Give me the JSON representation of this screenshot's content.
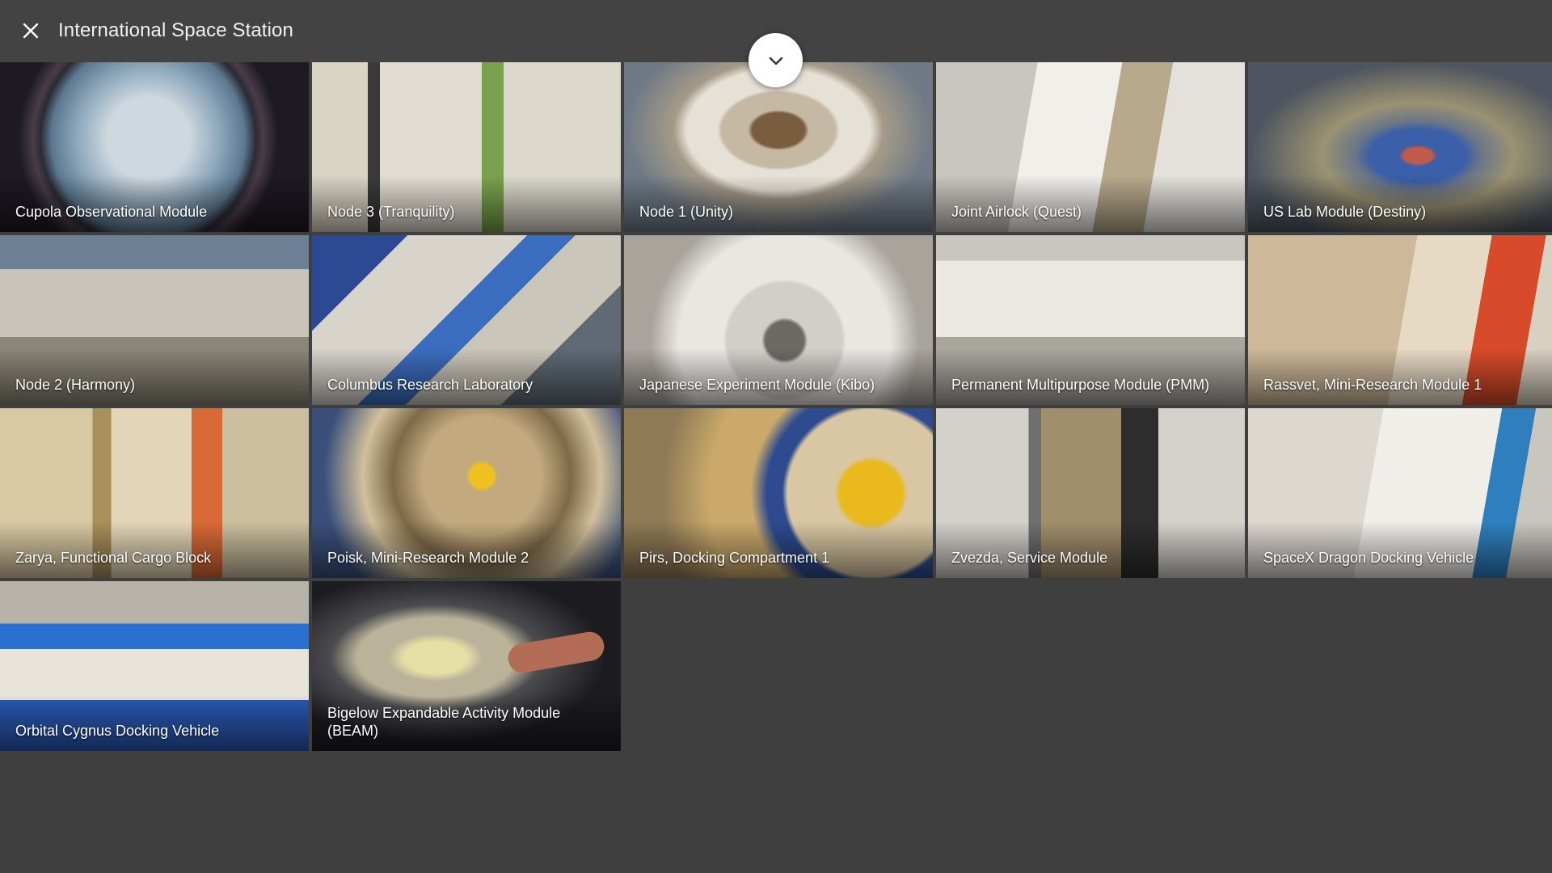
{
  "window": {
    "title": "International Space Station",
    "close_icon": "close-icon",
    "expand_icon": "chevron-down-icon"
  },
  "modules": [
    {
      "label": "Cupola Observational Module"
    },
    {
      "label": "Node 3 (Tranquility)"
    },
    {
      "label": "Node 1 (Unity)"
    },
    {
      "label": "Joint Airlock (Quest)"
    },
    {
      "label": "US Lab Module (Destiny)"
    },
    {
      "label": "Node 2 (Harmony)"
    },
    {
      "label": "Columbus Research Laboratory"
    },
    {
      "label": "Japanese Experiment Module (Kibo)"
    },
    {
      "label": "Permanent Multipurpose Module (PMM)"
    },
    {
      "label": "Rassvet, Mini-Research Module 1"
    },
    {
      "label": "Zarya, Functional Cargo Block"
    },
    {
      "label": "Poisk, Mini-Research Module 2"
    },
    {
      "label": "Pirs, Docking Compartment 1"
    },
    {
      "label": "Zvezda, Service Module"
    },
    {
      "label": "SpaceX Dragon Docking Vehicle"
    },
    {
      "label": "Orbital Cygnus Docking Vehicle"
    },
    {
      "label": "Bigelow Expandable Activity Module (BEAM)"
    }
  ],
  "colors": {
    "background": "#3f3f3f",
    "header": "#434343",
    "text": "#ffffff"
  }
}
